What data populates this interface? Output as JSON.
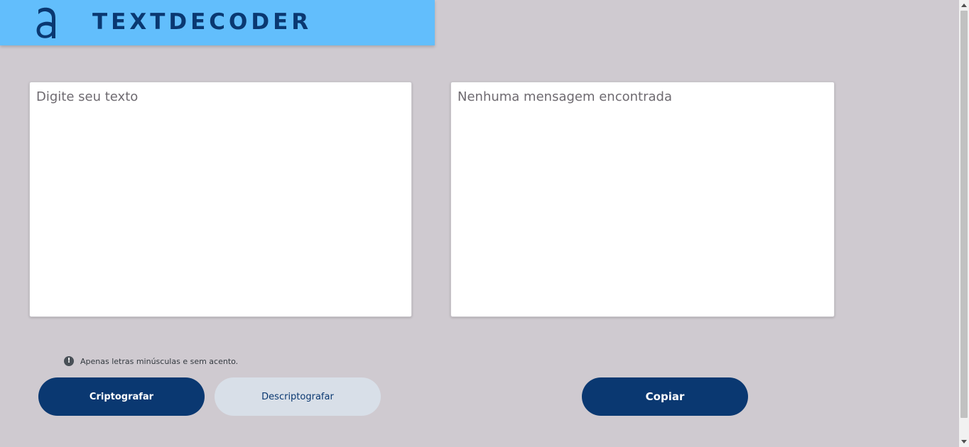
{
  "header": {
    "logo_icon": "alura-a-logo",
    "brand_name": "TEXTDECODER",
    "background_color": "#62befc",
    "brand_color": "#0a3871"
  },
  "input": {
    "placeholder": "Digite seu texto",
    "value": ""
  },
  "output": {
    "placeholder": "Nenhuma mensagem encontrada",
    "value": ""
  },
  "notice": {
    "icon": "exclamation-circle-icon",
    "text": "Apenas letras minúsculas e sem acento."
  },
  "buttons": {
    "encrypt_label": "Criptografar",
    "decrypt_label": "Descriptografar",
    "copy_label": "Copiar",
    "primary_color": "#0a3871",
    "secondary_color": "#d8dfe8"
  },
  "page": {
    "background_color": "#cfcad0"
  }
}
